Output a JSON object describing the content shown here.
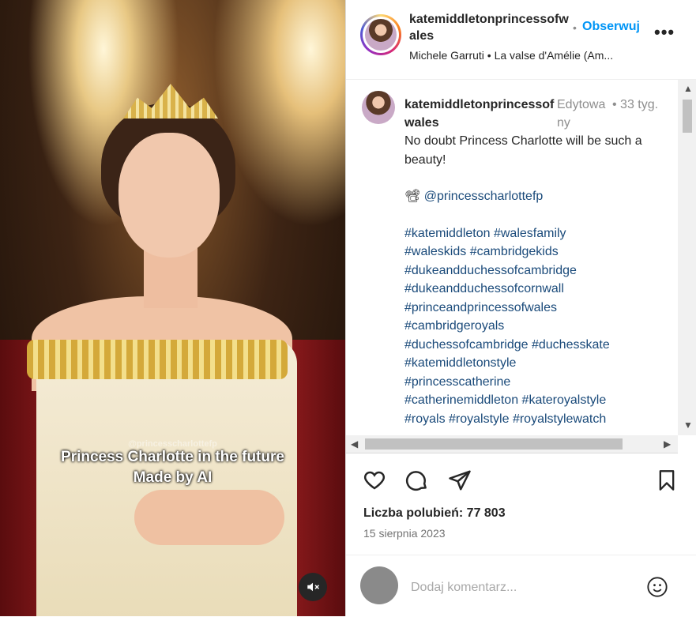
{
  "media": {
    "watermark": "@princesscharlottefp",
    "caption_line1": "Princess Charlotte in the future",
    "caption_line2": "Made by AI",
    "mute_icon": "speaker-muted-icon"
  },
  "header": {
    "username": "katemiddletonprincessofwales",
    "follow_separator": "•",
    "follow_label": "Obserwuj",
    "more_label": "•••",
    "audio": "Michele Garruti • La valse d'Amélie (Am..."
  },
  "comment": {
    "username": "katemiddletonprincessofwales",
    "edited": "Edytowany",
    "time": "• 33 tyg.",
    "text": "No doubt Princess Charlotte will be such a beauty!",
    "credit_emoji": "📽",
    "credit_handle": "@princesscharlottefp",
    "hashtags": [
      "#katemiddleton #walesfamily",
      "#waleskids #cambridgekids",
      "#dukeandduchessofcambridge",
      "#dukeandduchessofcornwall",
      "#princeandprincessofwales",
      "#cambridgeroyals",
      "#duchessofcambridge #duchesskate",
      "#katemiddletonstyle",
      "#princesscatherine",
      "#catherinemiddleton #kateroyalstyle",
      "#royals #royalstyle #royalstylewatch"
    ]
  },
  "actions": {
    "like_icon": "heart-icon",
    "comment_icon": "comment-icon",
    "share_icon": "send-icon",
    "save_icon": "bookmark-icon"
  },
  "likes": "Liczba polubień: 77 803",
  "date": "15 sierpnia 2023",
  "add_comment": {
    "placeholder": "Dodaj komentarz...",
    "emoji_icon": "smiley-icon"
  }
}
